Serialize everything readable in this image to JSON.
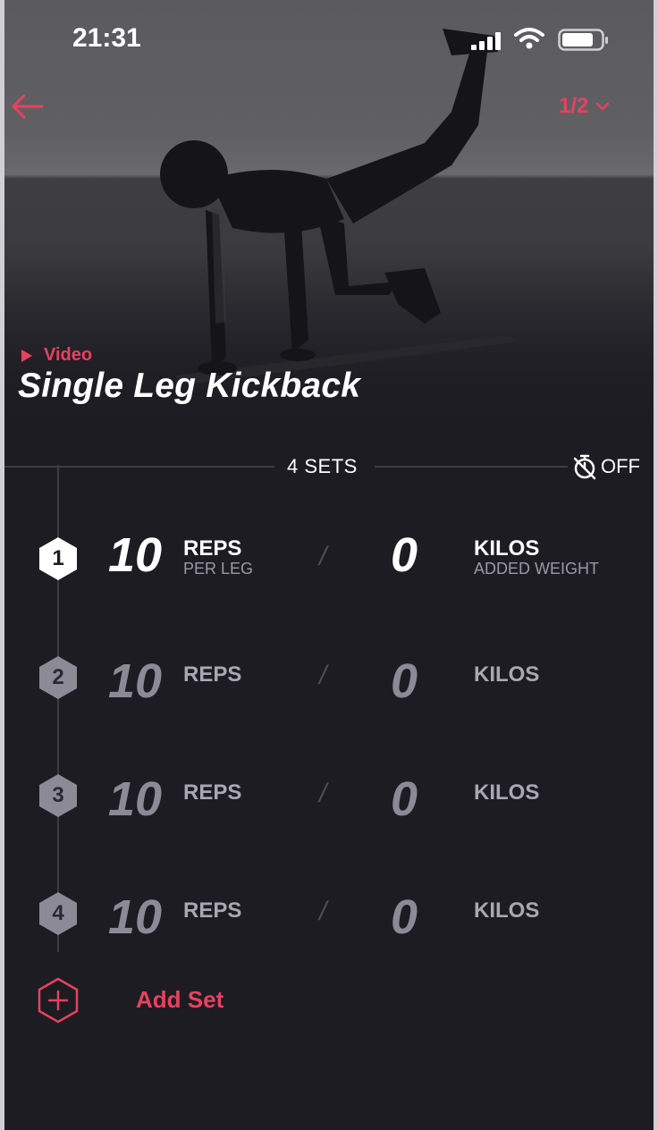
{
  "status_bar": {
    "time": "21:31"
  },
  "header": {
    "pager": "1/2"
  },
  "exercise": {
    "video_label": "Video",
    "title": "Single Leg Kickback"
  },
  "sets_bar": {
    "count_label": "4 SETS",
    "timer_label": "OFF"
  },
  "sets": [
    {
      "number": "1",
      "reps": "10",
      "reps_label": "REPS",
      "reps_sub": "PER LEG",
      "weight": "0",
      "weight_label": "KILOS",
      "weight_sub": "ADDED WEIGHT",
      "active": true
    },
    {
      "number": "2",
      "reps": "10",
      "reps_label": "REPS",
      "weight": "0",
      "weight_label": "KILOS",
      "active": false
    },
    {
      "number": "3",
      "reps": "10",
      "reps_label": "REPS",
      "weight": "0",
      "weight_label": "KILOS",
      "active": false
    },
    {
      "number": "4",
      "reps": "10",
      "reps_label": "REPS",
      "weight": "0",
      "weight_label": "KILOS",
      "active": false
    }
  ],
  "separator": "/",
  "add_set": {
    "label": "Add Set"
  },
  "colors": {
    "accent": "#e8415f",
    "background": "#1d1c23",
    "inactive": "#8b8a96"
  },
  "icons": [
    "signal-icon",
    "wifi-icon",
    "battery-icon",
    "back-arrow-icon",
    "chevron-down-icon",
    "play-icon",
    "timer-off-icon",
    "hexagon-icon",
    "add-icon"
  ]
}
